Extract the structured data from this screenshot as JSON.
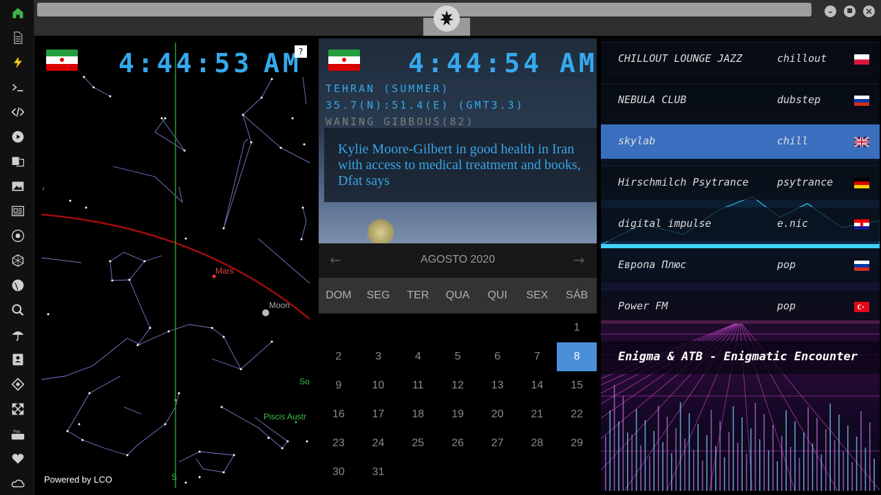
{
  "sidebar": {
    "items": [
      {
        "name": "home-icon",
        "glyph": "home",
        "color": "#3cb44b"
      },
      {
        "name": "document-icon",
        "glyph": "doc",
        "color": "#cfcfcf"
      },
      {
        "name": "lightning-icon",
        "glyph": "bolt",
        "color": "#f0c419"
      },
      {
        "name": "terminal-icon",
        "glyph": "term",
        "color": "#cfcfcf"
      },
      {
        "name": "code-icon",
        "glyph": "code",
        "color": "#cfcfcf"
      },
      {
        "name": "play-icon",
        "glyph": "play",
        "color": "#cfcfcf"
      },
      {
        "name": "translate-icon",
        "glyph": "trans",
        "color": "#cfcfcf"
      },
      {
        "name": "image-icon",
        "glyph": "img",
        "color": "#cfcfcf"
      },
      {
        "name": "news-icon",
        "glyph": "news",
        "color": "#cfcfcf"
      },
      {
        "name": "rebel-icon",
        "glyph": "rebel",
        "color": "#cfcfcf"
      },
      {
        "name": "hexagon-icon",
        "glyph": "hex",
        "color": "#cfcfcf"
      },
      {
        "name": "globe-icon",
        "glyph": "globe",
        "color": "#cfcfcf"
      },
      {
        "name": "search-icon",
        "glyph": "search",
        "color": "#cfcfcf"
      },
      {
        "name": "umbrella-icon",
        "glyph": "umb",
        "color": "#cfcfcf"
      },
      {
        "name": "contact-icon",
        "glyph": "contact",
        "color": "#cfcfcf"
      },
      {
        "name": "tag-icon",
        "glyph": "tag",
        "color": "#cfcfcf"
      },
      {
        "name": "expand-icon",
        "glyph": "expand",
        "color": "#cfcfcf"
      },
      {
        "name": "youtube-icon",
        "glyph": "yt",
        "color": "#cfcfcf"
      },
      {
        "name": "heart-icon",
        "glyph": "heart",
        "color": "#cfcfcf"
      },
      {
        "name": "cloud-icon",
        "glyph": "cloud",
        "color": "#cfcfcf"
      }
    ]
  },
  "window": {
    "minimize": "–",
    "maximize": "■",
    "close": "×"
  },
  "sky": {
    "time": "4:44:53",
    "ampm": "AM",
    "help": "?",
    "powered_by": "Powered by LCO",
    "labels": {
      "mars": "Mars",
      "moon": "Moon",
      "so": "So",
      "piscis": "Piscis Austr",
      "s": "S"
    }
  },
  "location": {
    "time": "4:44:54",
    "ampm": "AM",
    "city": "TEHRAN (SUMMER)",
    "coords": "35.7(N):51.4(E) (GMT3.3)",
    "moon_phase": "WANING GIBBOUS(82)",
    "headline": "Kylie Moore-Gilbert in good health in Iran with access to medical treatment and books, Dfat says"
  },
  "calendar": {
    "title": "AGOSTO 2020",
    "prev": "←",
    "next": "→",
    "days_of_week": [
      "DOM",
      "SEG",
      "TER",
      "QUA",
      "QUI",
      "SEX",
      "SÁB"
    ],
    "first_weekday": 6,
    "days_in_month": 31,
    "selected_day": 8,
    "accent": "#4a90d9"
  },
  "radio": {
    "stations": [
      {
        "name": "CHILLOUT LOUNGE JAZZ",
        "genre": "chillout",
        "flag": "pl"
      },
      {
        "name": "NEBULA CLUB",
        "genre": "dubstep",
        "flag": "ru"
      },
      {
        "name": "skylab",
        "genre": "chill",
        "flag": "gb",
        "active": true
      },
      {
        "name": "Hirschmilch Psytrance",
        "genre": "psytrance",
        "flag": "de"
      },
      {
        "name": "digital impulse",
        "genre": "e.nic",
        "flag": "hr"
      },
      {
        "name": "Европа Плюс",
        "genre": "pop",
        "flag": "ru"
      },
      {
        "name": "Power FM",
        "genre": "pop",
        "flag": "tr"
      }
    ],
    "now_playing": "Enigma & ATB - Enigmatic Encounter"
  }
}
